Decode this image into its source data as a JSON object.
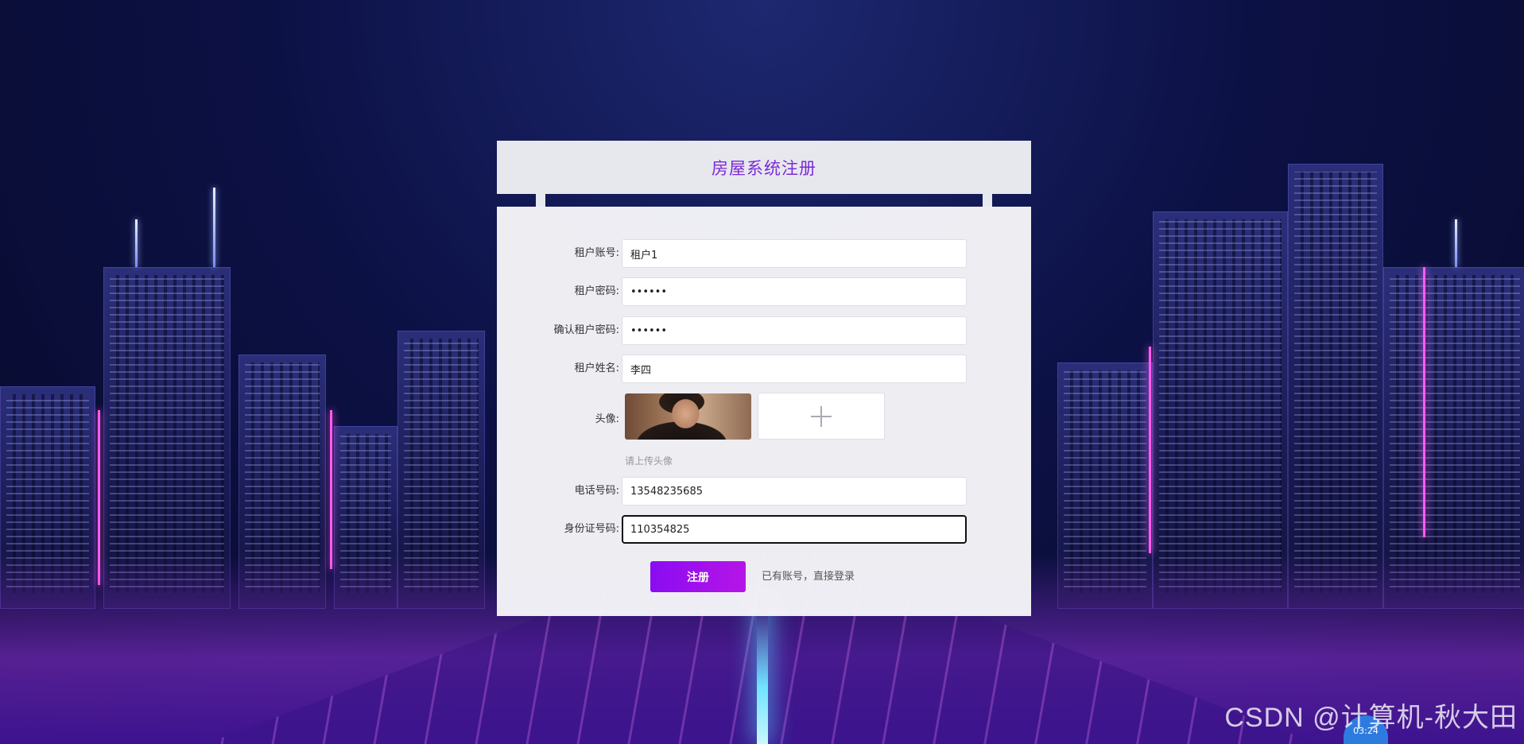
{
  "form": {
    "title": "房屋系统注册",
    "fields": {
      "account": {
        "label": "租户账号:",
        "value": "租户1"
      },
      "password": {
        "label": "租户密码:",
        "value": "••••••"
      },
      "confirm": {
        "label": "确认租户密码:",
        "value": "••••••"
      },
      "name": {
        "label": "租户姓名:",
        "value": "李四"
      },
      "phone": {
        "label": "电话号码:",
        "value": "13548235685"
      },
      "id_number": {
        "label": "身份证号码:",
        "value": "110354825"
      }
    },
    "avatar": {
      "label": "头像:",
      "hint": "请上传头像",
      "upload_icon": "plus-icon"
    },
    "register_label": "注册",
    "login_link": "已有账号，直接登录"
  },
  "watermark": "CSDN @计算机-秋大田",
  "clock_badge": "03:24",
  "colors": {
    "title": "#7b2ad8",
    "button_start": "#8a0cf2",
    "button_end": "#b615e6"
  }
}
